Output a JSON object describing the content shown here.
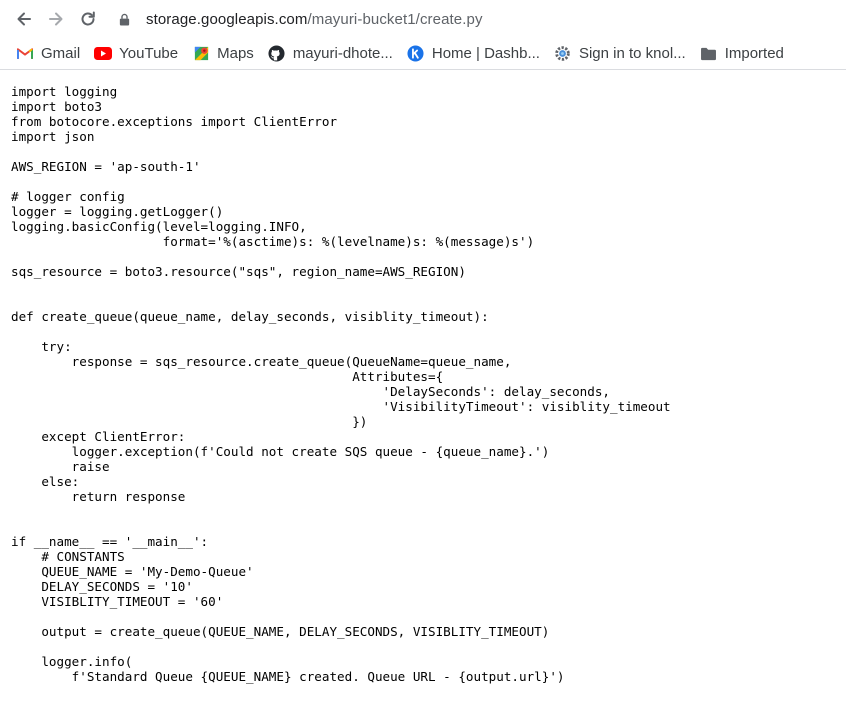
{
  "browser": {
    "url_domain": "storage.googleapis.com",
    "url_path": "/mayuri-bucket1/create.py"
  },
  "bookmarks": [
    {
      "label": "Gmail",
      "icon": "gmail-icon"
    },
    {
      "label": "YouTube",
      "icon": "youtube-icon"
    },
    {
      "label": "Maps",
      "icon": "maps-icon"
    },
    {
      "label": "mayuri-dhote...",
      "icon": "github-icon"
    },
    {
      "label": "Home | Dashb...",
      "icon": "knoldus-icon"
    },
    {
      "label": "Sign in to knol...",
      "icon": "knol-icon"
    },
    {
      "label": "Imported",
      "icon": "folder-icon"
    }
  ],
  "file": {
    "content": "import logging\nimport boto3\nfrom botocore.exceptions import ClientError\nimport json\n\nAWS_REGION = 'ap-south-1'\n\n# logger config\nlogger = logging.getLogger()\nlogging.basicConfig(level=logging.INFO,\n                    format='%(asctime)s: %(levelname)s: %(message)s')\n\nsqs_resource = boto3.resource(\"sqs\", region_name=AWS_REGION)\n\n\ndef create_queue(queue_name, delay_seconds, visiblity_timeout):\n\n    try:\n        response = sqs_resource.create_queue(QueueName=queue_name,\n                                             Attributes={\n                                                 'DelaySeconds': delay_seconds,\n                                                 'VisibilityTimeout': visiblity_timeout\n                                             })\n    except ClientError:\n        logger.exception(f'Could not create SQS queue - {queue_name}.')\n        raise\n    else:\n        return response\n\n\nif __name__ == '__main__':\n    # CONSTANTS\n    QUEUE_NAME = 'My-Demo-Queue'\n    DELAY_SECONDS = '10'\n    VISIBLITY_TIMEOUT = '60'\n\n    output = create_queue(QUEUE_NAME, DELAY_SECONDS, VISIBLITY_TIMEOUT)\n\n    logger.info(\n        f'Standard Queue {QUEUE_NAME} created. Queue URL - {output.url}')"
  }
}
